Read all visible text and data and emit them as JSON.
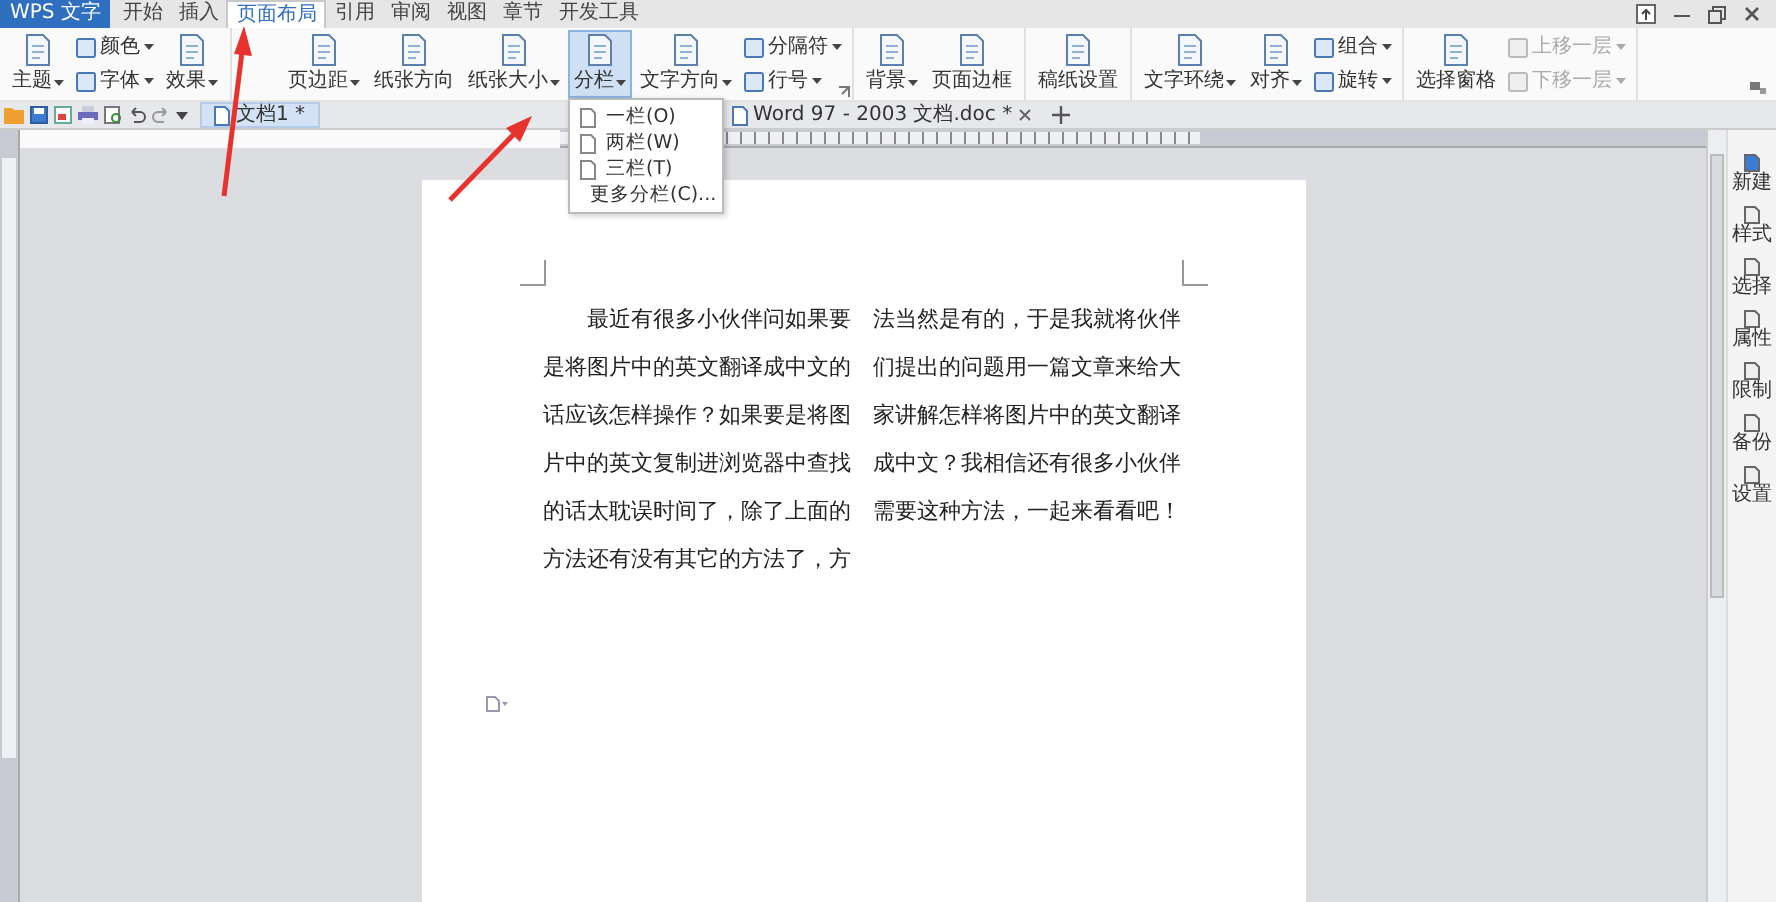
{
  "app_button": {
    "label": "WPS 文字"
  },
  "tabs": [
    {
      "label": "开始",
      "selected": false
    },
    {
      "label": "插入",
      "selected": false
    },
    {
      "label": "页面布局",
      "selected": true
    },
    {
      "label": "引用",
      "selected": false
    },
    {
      "label": "审阅",
      "selected": false
    },
    {
      "label": "视图",
      "selected": false
    },
    {
      "label": "章节",
      "selected": false
    },
    {
      "label": "开发工具",
      "selected": false
    }
  ],
  "ribbon": {
    "groups": [
      {
        "columns": [
          {
            "kind": "large",
            "label": "主题",
            "dropdown": true,
            "selected": false
          },
          {
            "kind": "stack",
            "items": [
              {
                "label": "颜色",
                "dropdown": true,
                "disabled": false
              },
              {
                "label": "字体",
                "dropdown": true,
                "disabled": false
              }
            ]
          },
          {
            "kind": "large",
            "label": "效果",
            "dropdown": true,
            "selected": false
          }
        ]
      },
      {
        "columns": [
          {
            "kind": "large",
            "label": "页边距",
            "dropdown": true,
            "selected": false
          },
          {
            "kind": "large",
            "label": "纸张方向",
            "dropdown": false,
            "selected": false
          },
          {
            "kind": "large",
            "label": "纸张大小",
            "dropdown": true,
            "selected": false
          },
          {
            "kind": "large",
            "label": "分栏",
            "dropdown": true,
            "selected": true
          },
          {
            "kind": "large",
            "label": "文字方向",
            "dropdown": true,
            "selected": false
          },
          {
            "kind": "stack",
            "items": [
              {
                "label": "分隔符",
                "dropdown": true,
                "disabled": false
              },
              {
                "label": "行号",
                "dropdown": true,
                "disabled": false
              }
            ]
          },
          {
            "kind": "launcher"
          }
        ]
      },
      {
        "columns": [
          {
            "kind": "large",
            "label": "背景",
            "dropdown": true,
            "selected": false
          },
          {
            "kind": "large",
            "label": "页面边框",
            "dropdown": false,
            "selected": false
          }
        ]
      },
      {
        "columns": [
          {
            "kind": "large",
            "label": "稿纸设置",
            "dropdown": false,
            "selected": false
          }
        ]
      },
      {
        "columns": [
          {
            "kind": "large",
            "label": "文字环绕",
            "dropdown": true,
            "selected": false
          },
          {
            "kind": "large",
            "label": "对齐",
            "dropdown": true,
            "selected": false
          },
          {
            "kind": "stack",
            "items": [
              {
                "label": "组合",
                "dropdown": true,
                "disabled": false
              },
              {
                "label": "旋转",
                "dropdown": true,
                "disabled": false
              }
            ]
          }
        ]
      },
      {
        "columns": [
          {
            "kind": "large",
            "label": "选择窗格",
            "dropdown": false,
            "selected": false
          },
          {
            "kind": "stack",
            "items": [
              {
                "label": "上移一层",
                "dropdown": true,
                "disabled": true
              },
              {
                "label": "下移一层",
                "dropdown": true,
                "disabled": true
              }
            ]
          }
        ]
      }
    ]
  },
  "doc_tabs": [
    {
      "label": "文档1 *",
      "selected": true,
      "closable": false
    },
    {
      "label": "Word 97 - 2003 文档.doc *",
      "selected": false,
      "closable": true
    }
  ],
  "column_menu": {
    "items": [
      "一栏(O)",
      "两栏(W)",
      "三栏(T)",
      "更多分栏(C)..."
    ]
  },
  "document": {
    "text": "最近有很多小伙伴问如果要是将图片中的英文翻译成中文的话应该怎样操作？如果要是将图片中的英文复制进浏览器中查找的话太耽误时间了，除了上面的方法还有没有其它的方法了，方法当然是有的，于是我就将伙伴们提出的问题用一篇文章来给大家讲解怎样将图片中的英文翻译成中文？我相信还有很多小伙伴需要这种方法，一起来看看吧！"
  },
  "sidebar": {
    "items": [
      "新建",
      "样式",
      "选择",
      "属性",
      "限制",
      "备份",
      "设置"
    ]
  }
}
